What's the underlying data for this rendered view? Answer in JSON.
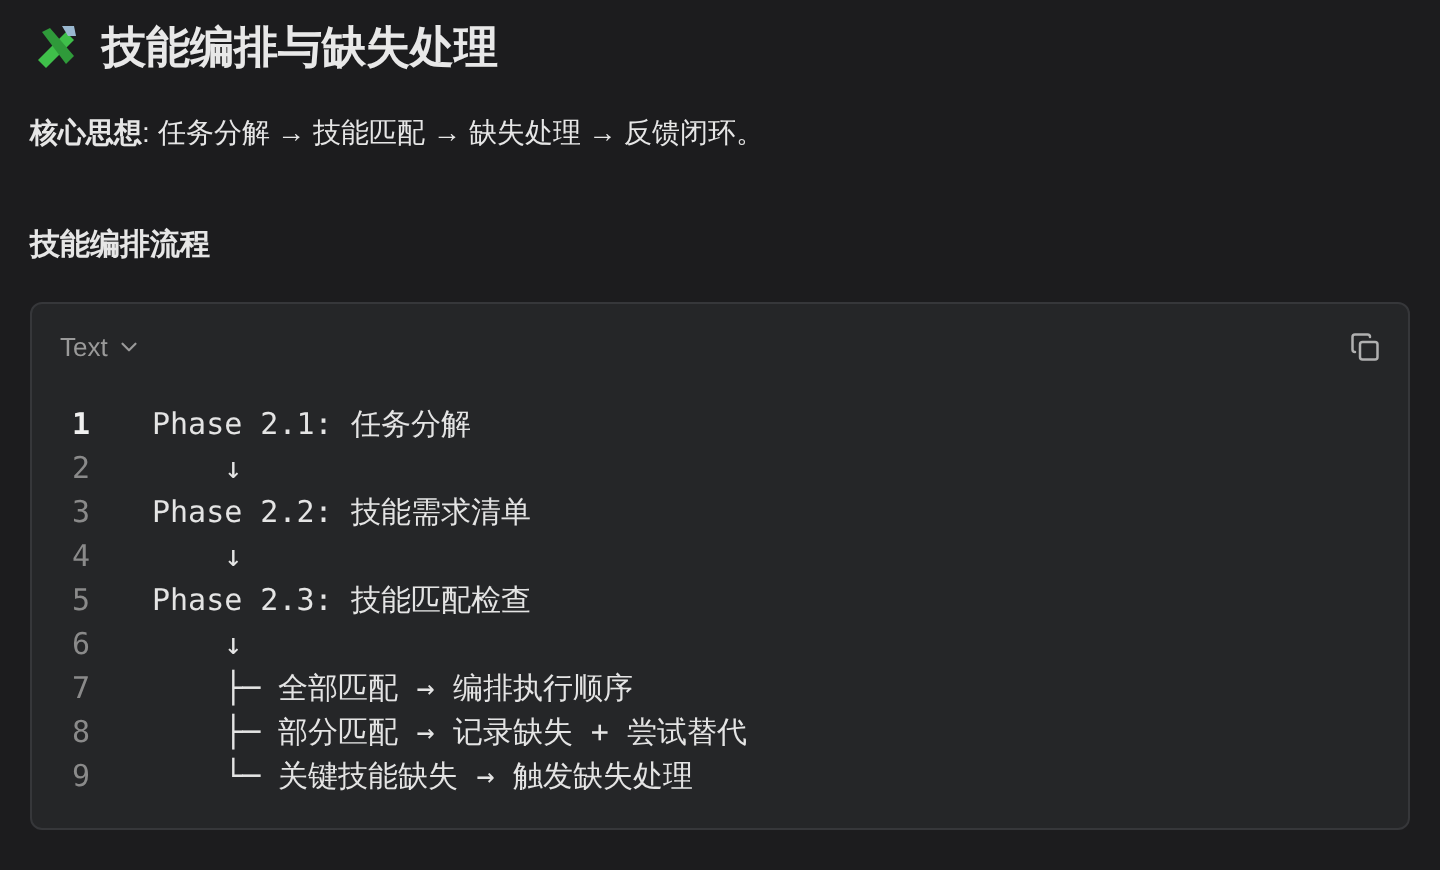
{
  "title": "技能编排与缺失处理",
  "intro": "**核心思想**: 任务分解 → 技能匹配 → 缺失处理 → 反馈闭环。",
  "section_heading": "技能编排流程",
  "code_block": {
    "language": "Text",
    "lines": [
      {
        "number": "1",
        "text": "Phase 2.1: 任务分解",
        "current": true
      },
      {
        "number": "2",
        "text": "    ↓",
        "current": false
      },
      {
        "number": "3",
        "text": "Phase 2.2: 技能需求清单",
        "current": false
      },
      {
        "number": "4",
        "text": "    ↓",
        "current": false
      },
      {
        "number": "5",
        "text": "Phase 2.3: 技能匹配检查",
        "current": false
      },
      {
        "number": "6",
        "text": "    ↓",
        "current": false
      },
      {
        "number": "7",
        "text": "    ├─ 全部匹配 → 编排执行顺序",
        "current": false
      },
      {
        "number": "8",
        "text": "    ├─ 部分匹配 → 记录缺失 + 尝试替代",
        "current": false
      },
      {
        "number": "9",
        "text": "    └─ 关键技能缺失 → 触发缺失处理",
        "current": false
      }
    ]
  }
}
